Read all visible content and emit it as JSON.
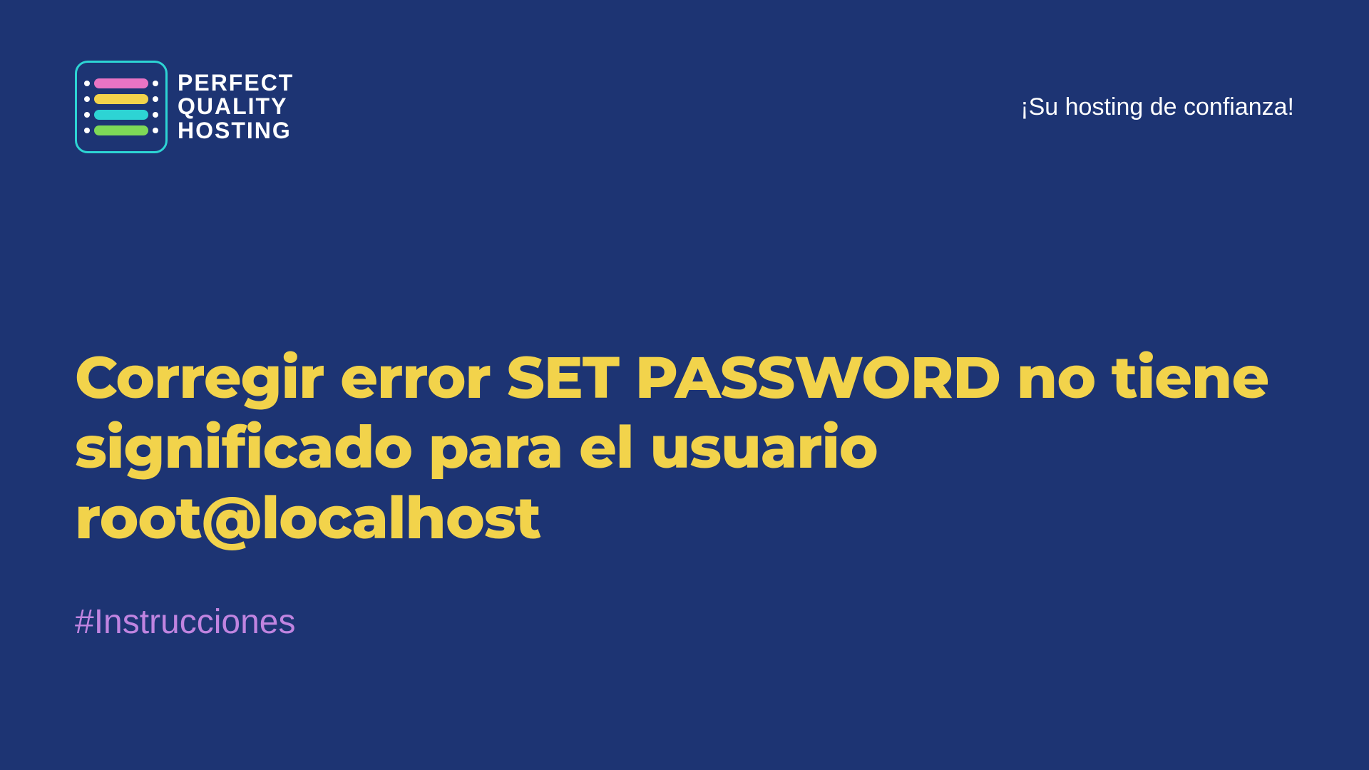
{
  "logo": {
    "line1": "Perfect",
    "line2": "Quality",
    "line3": "Hosting"
  },
  "tagline": "¡Su hosting de confianza!",
  "main": {
    "title": "Corregir error SET PASSWORD no tiene significado para el usuario root@localhost",
    "hashtag": "#Instrucciones"
  },
  "colors": {
    "bg": "#1d3473",
    "title": "#f2d34b",
    "hashtag": "#c084e0",
    "accent_cyan": "#2dd4d4",
    "accent_pink": "#e974c4",
    "accent_green": "#7ed957"
  }
}
